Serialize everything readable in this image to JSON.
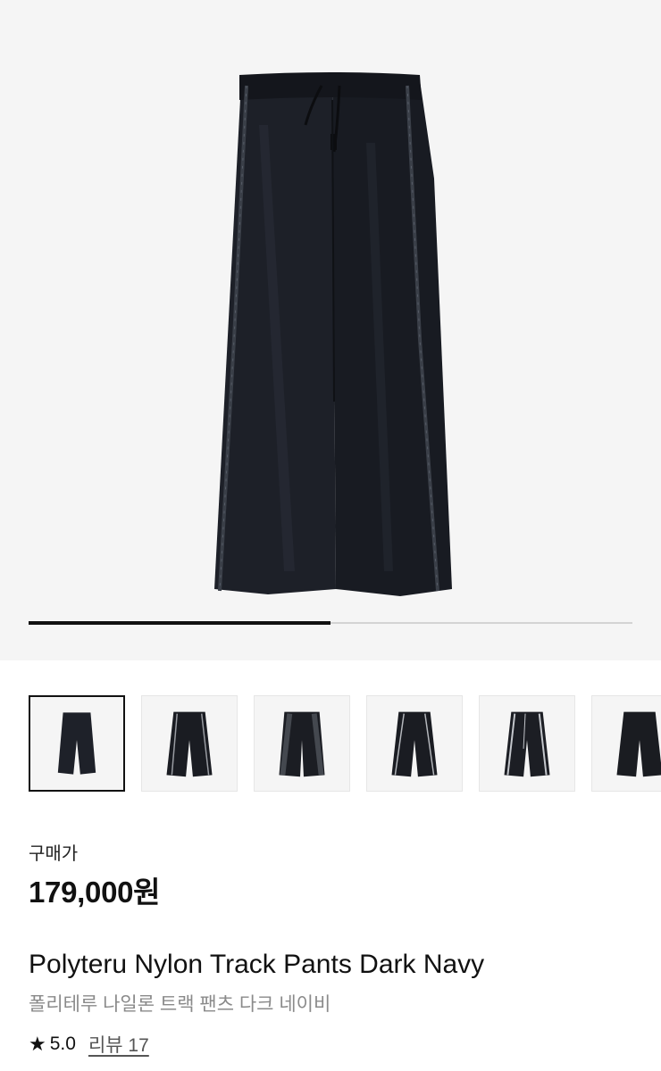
{
  "gallery": {
    "main_image": "black nylon track pants with side zip tape detail",
    "progress": 0.5,
    "thumbnails": [
      {
        "image": "pants-front",
        "selected": true
      },
      {
        "image": "pants-front-zip-open",
        "selected": false
      },
      {
        "image": "pants-side-tape",
        "selected": false
      },
      {
        "image": "pants-front-zip-open",
        "selected": false
      },
      {
        "image": "pants-side-zip",
        "selected": false
      },
      {
        "image": "pants-back",
        "selected": false
      }
    ]
  },
  "product": {
    "price_label": "구매가",
    "price": "179,000원",
    "name_en": "Polyteru Nylon Track Pants Dark Navy",
    "name_ko": "폴리테루 나일론 트랙 팬츠 다크 네이비"
  },
  "rating": {
    "icon": "star-icon",
    "score": "5.0",
    "review_text": "리뷰 17"
  },
  "colors": {
    "pants": "#1c1f26",
    "background": "#f5f5f5",
    "accent": "#111111"
  }
}
